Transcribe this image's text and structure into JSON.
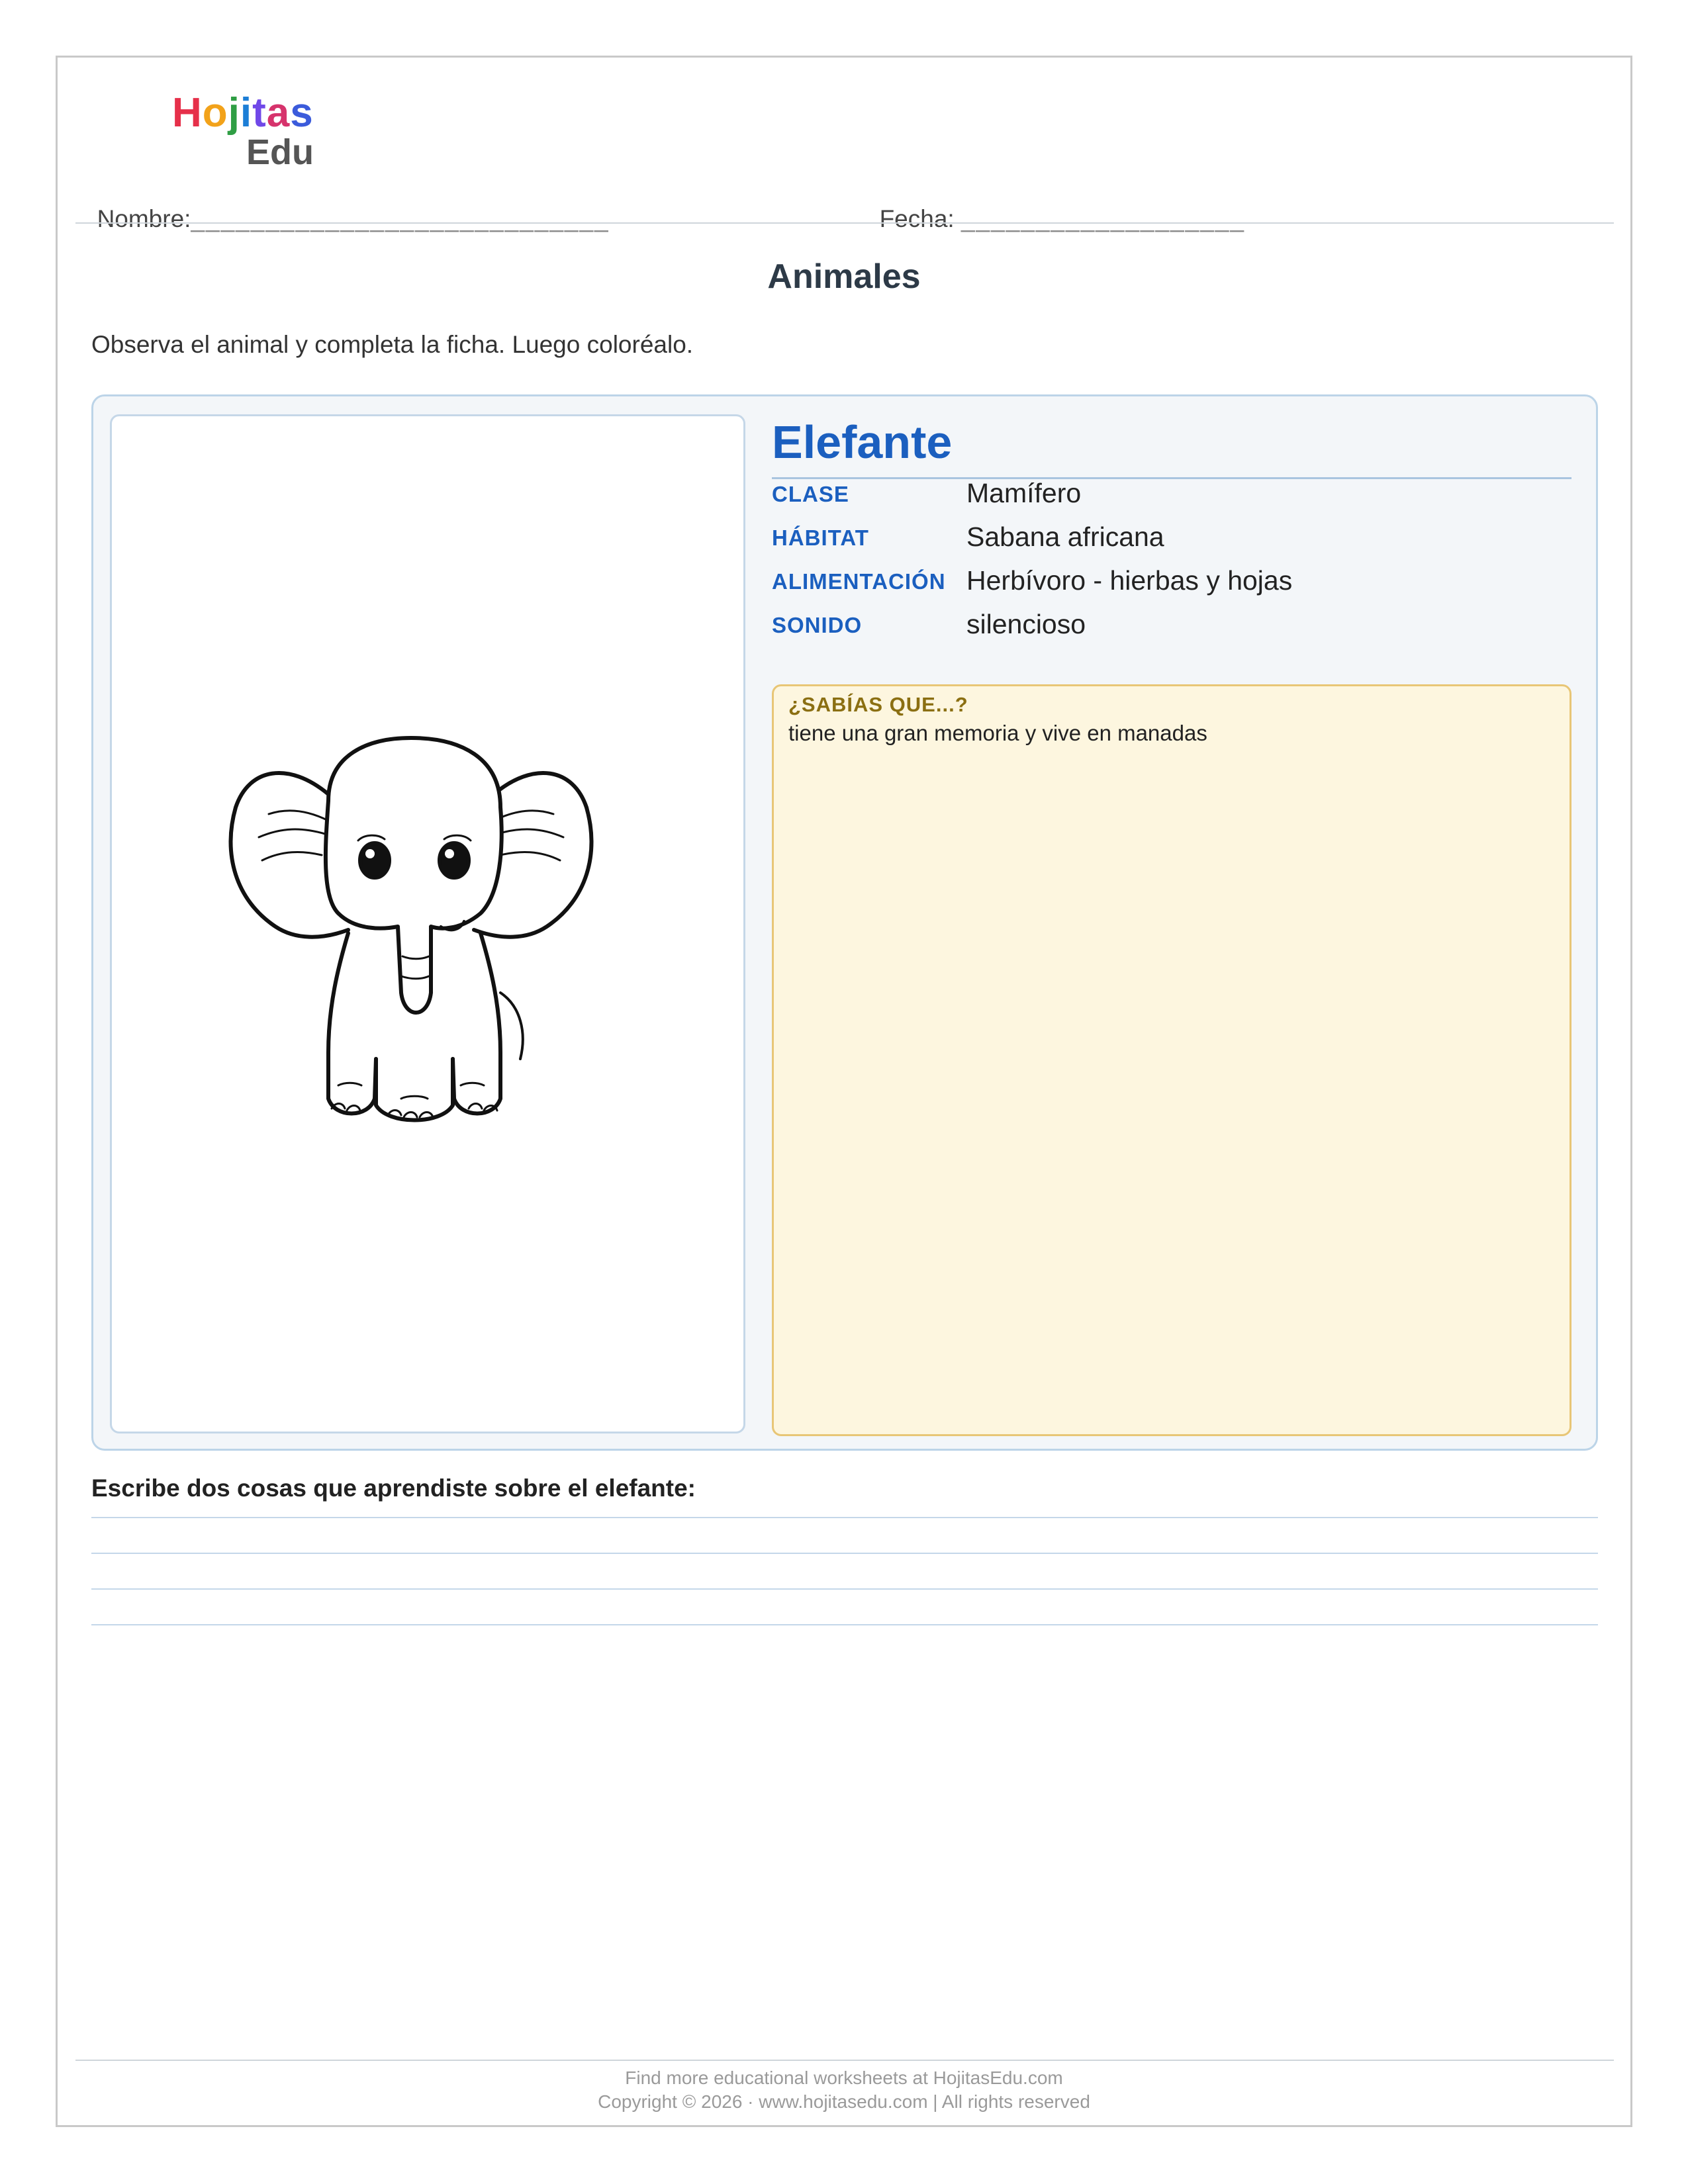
{
  "header": {
    "logo": {
      "word1": "Hojitas",
      "word2": "Edu"
    },
    "name_label": "Nombre:",
    "name_line": "____________________________",
    "date_label": "Fecha:",
    "date_line": "___________________"
  },
  "title": "Animales",
  "instructions": "Observa el animal y completa la ficha. Luego coloréalo.",
  "animal": {
    "name": "Elefante",
    "facts": [
      {
        "key": "CLASE",
        "value": "Mamífero"
      },
      {
        "key": "HÁBITAT",
        "value": "Sabana africana"
      },
      {
        "key": "ALIMENTACIÓN",
        "value": "Herbívoro - hierbas y hojas"
      },
      {
        "key": "SONIDO",
        "value": "silencioso"
      }
    ],
    "did_you_know": {
      "heading": "¿SABÍAS QUE...?",
      "text": "tiene una gran memoria y vive en manadas"
    },
    "illustration": "elephant-coloring-icon"
  },
  "question": "Escribe dos cosas que aprendiste sobre el elefante:",
  "footer": {
    "line1": "Find more educational worksheets at HojitasEdu.com",
    "line2": "Copyright © 2026  ·  www.hojitasedu.com  |  All rights reserved"
  },
  "colors": {
    "accent": "#1b5fbf",
    "fact_bg": "#fdf6df",
    "fact_border": "#e8c676",
    "card_bg": "#f3f6f9"
  }
}
